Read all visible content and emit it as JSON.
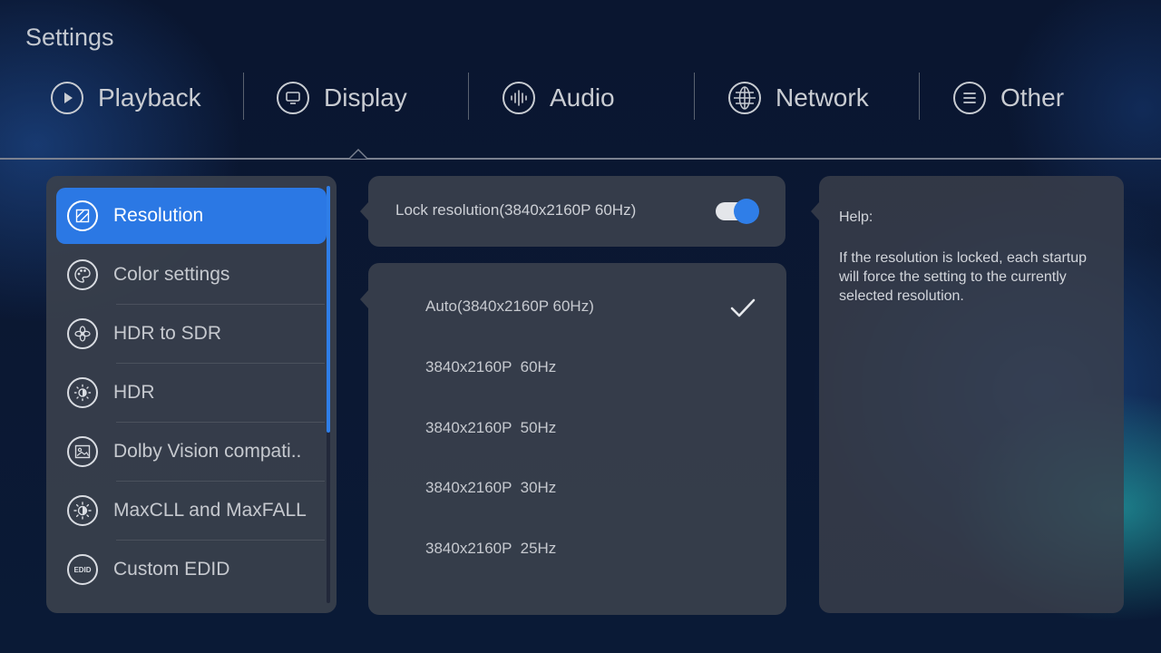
{
  "page_title": "Settings",
  "tabs": [
    {
      "label": "Playback",
      "icon": "play-icon"
    },
    {
      "label": "Display",
      "icon": "monitor-icon"
    },
    {
      "label": "Audio",
      "icon": "audio-wave-icon"
    },
    {
      "label": "Network",
      "icon": "globe-icon"
    },
    {
      "label": "Other",
      "icon": "menu-lines-icon"
    }
  ],
  "selected_tab": "Display",
  "sidebar": {
    "items": [
      {
        "label": "Resolution",
        "icon": "resolution-icon"
      },
      {
        "label": "Color settings",
        "icon": "palette-icon"
      },
      {
        "label": "HDR to SDR",
        "icon": "aperture-icon"
      },
      {
        "label": "HDR",
        "icon": "hdr-sun-icon"
      },
      {
        "label": "Dolby Vision compati..",
        "icon": "image-icon"
      },
      {
        "label": "MaxCLL and MaxFALL",
        "icon": "brightness-icon"
      },
      {
        "label": "Custom EDID",
        "icon": "edid-icon"
      }
    ],
    "active_index": 0
  },
  "edid_badge": "EDID",
  "lock": {
    "label": "Lock resolution(3840x2160P 60Hz)",
    "enabled": true
  },
  "resolutions": {
    "items": [
      "Auto(3840x2160P 60Hz)",
      "3840x2160P  60Hz",
      "3840x2160P  50Hz",
      "3840x2160P  30Hz",
      "3840x2160P  25Hz"
    ],
    "selected_index": 0
  },
  "help": {
    "title": "Help:",
    "text": "If the resolution is locked, each startup will force the setting to the currently selected resolution."
  },
  "colors": {
    "accent": "#2b78e4",
    "panel": "#3a404c",
    "background": "#0b1833"
  }
}
